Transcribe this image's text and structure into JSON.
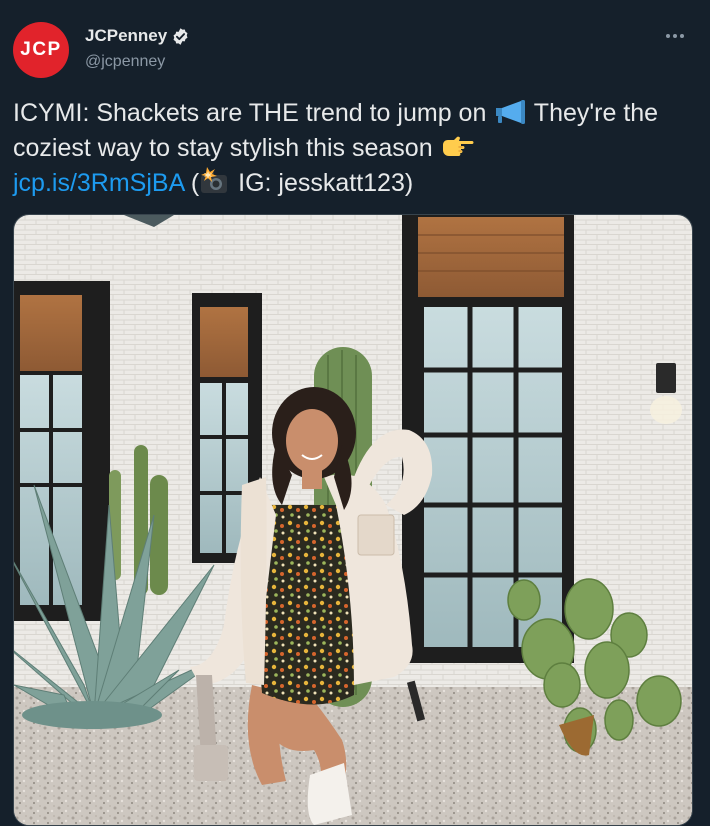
{
  "tweet": {
    "avatar_text": "JCP",
    "display_name": "JCPenney",
    "handle": "@jcpenney",
    "text_part1": "ICYMI: Shackets are THE trend to jump on ",
    "text_part2": " They're the coziest way to stay stylish this season ",
    "link": "jcp.is/3RmSjBA",
    "text_part3": " (",
    "text_part4": " IG: jesskatt123)"
  },
  "icons": {
    "verified": "verified-badge-icon",
    "more": "more-options-icon",
    "megaphone": "megaphone-emoji",
    "pointing": "pointing-right-emoji",
    "camera": "camera-flash-emoji"
  },
  "colors": {
    "background": "#15202b",
    "brand_red": "#e1232b",
    "link_blue": "#1d9bf0",
    "text": "#e7e9ea",
    "secondary_text": "#8b98a5"
  }
}
